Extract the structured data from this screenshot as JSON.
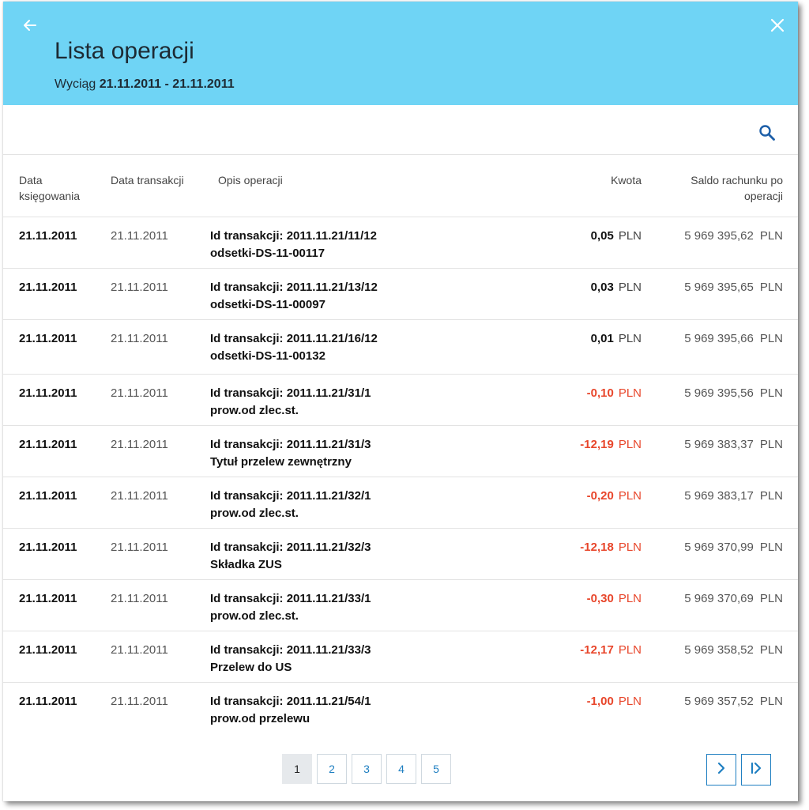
{
  "header": {
    "title": "Lista operacji",
    "subtitle_prefix": "Wyciąg",
    "date_range": "21.11.2011 - 21.11.2011"
  },
  "icons": {
    "back": "arrow-left-icon",
    "close": "close-icon",
    "search": "search-icon",
    "next": "chevron-right-icon",
    "last": "last-page-icon"
  },
  "colors": {
    "header_bg": "#6fd4f5",
    "negative": "#e8462b",
    "link": "#1f7fc1"
  },
  "table": {
    "columns": {
      "posting_date": "Data księgowania",
      "transaction_date": "Data transakcji",
      "description": "Opis operacji",
      "amount": "Kwota",
      "balance": "Saldo rachunku po operacji"
    },
    "rows": [
      {
        "posting": "21.11.2011",
        "tx": "21.11.2011",
        "id": "Id transakcji: 2011.11.21/11/12",
        "desc": "odsetki-DS-11-00117",
        "amount": "0,05",
        "cur": "PLN",
        "balance": "5 969 395,62",
        "bcur": "PLN"
      },
      {
        "posting": "21.11.2011",
        "tx": "21.11.2011",
        "id": "Id transakcji: 2011.11.21/13/12",
        "desc": "odsetki-DS-11-00097",
        "amount": "0,03",
        "cur": "PLN",
        "balance": "5 969 395,65",
        "bcur": "PLN"
      },
      {
        "posting": "21.11.2011",
        "tx": "21.11.2011",
        "id": "Id transakcji: 2011.11.21/16/12",
        "desc": "odsetki-DS-11-00132",
        "amount": "0,01",
        "cur": "PLN",
        "balance": "5 969 395,66",
        "bcur": "PLN"
      },
      {
        "posting": "21.11.2011",
        "tx": "21.11.2011",
        "id": "Id transakcji: 2011.11.21/31/1",
        "desc": "prow.od zlec.st.",
        "amount": "-0,10",
        "cur": "PLN",
        "balance": "5 969 395,56",
        "bcur": "PLN"
      },
      {
        "posting": "21.11.2011",
        "tx": "21.11.2011",
        "id": "Id transakcji: 2011.11.21/31/3",
        "desc": "Tytuł przelew zewnętrzny",
        "amount": "-12,19",
        "cur": "PLN",
        "balance": "5 969 383,37",
        "bcur": "PLN"
      },
      {
        "posting": "21.11.2011",
        "tx": "21.11.2011",
        "id": "Id transakcji: 2011.11.21/32/1",
        "desc": "prow.od zlec.st.",
        "amount": "-0,20",
        "cur": "PLN",
        "balance": "5 969 383,17",
        "bcur": "PLN"
      },
      {
        "posting": "21.11.2011",
        "tx": "21.11.2011",
        "id": "Id transakcji: 2011.11.21/32/3",
        "desc": "Składka ZUS",
        "amount": "-12,18",
        "cur": "PLN",
        "balance": "5 969 370,99",
        "bcur": "PLN"
      },
      {
        "posting": "21.11.2011",
        "tx": "21.11.2011",
        "id": "Id transakcji: 2011.11.21/33/1",
        "desc": "prow.od zlec.st.",
        "amount": "-0,30",
        "cur": "PLN",
        "balance": "5 969 370,69",
        "bcur": "PLN"
      },
      {
        "posting": "21.11.2011",
        "tx": "21.11.2011",
        "id": "Id transakcji: 2011.11.21/33/3",
        "desc": "Przelew do US",
        "amount": "-12,17",
        "cur": "PLN",
        "balance": "5 969 358,52",
        "bcur": "PLN"
      },
      {
        "posting": "21.11.2011",
        "tx": "21.11.2011",
        "id": "Id transakcji: 2011.11.21/54/1",
        "desc": "prow.od przelewu",
        "amount": "-1,00",
        "cur": "PLN",
        "balance": "5 969 357,52",
        "bcur": "PLN"
      }
    ]
  },
  "pagination": {
    "pages": [
      "1",
      "2",
      "3",
      "4",
      "5"
    ],
    "current": "1"
  }
}
